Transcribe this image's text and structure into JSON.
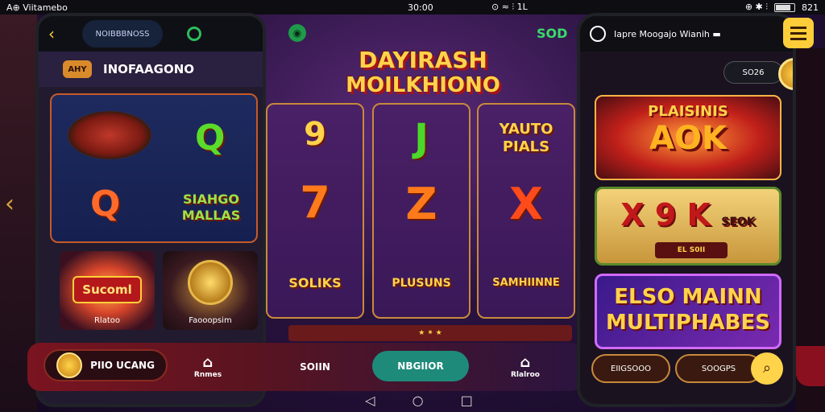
{
  "statusbar": {
    "left_text": "A⊕ Viitamebo",
    "time": "30:00",
    "right_a": "⊙ ≈ ⫶ 1L",
    "right_b": "⊕ ✱ ⫶",
    "battery_text": "821"
  },
  "left_phone": {
    "pill_label": "NOIBBBNOSS",
    "tag_label": "AHY",
    "section_title": "INOFAAGONO",
    "symbols": {
      "q1": "Q",
      "q2": "Q",
      "slot_text": "SIAHGO MALLAS"
    },
    "thumbs": [
      {
        "badge": "Sucoml",
        "label": "Rlatoo"
      },
      {
        "label": "Faooopsim"
      }
    ]
  },
  "header": {
    "balance": "SOD"
  },
  "logo": {
    "line1": "DAYIRASH",
    "line2": "MOILKHIONO"
  },
  "reels": [
    {
      "top": "9",
      "mid": "7",
      "bottom": "SOLIKS"
    },
    {
      "top": "J",
      "mid": "Z",
      "bottom": "PLUSUNS"
    },
    {
      "top": "YAUTO PIALS",
      "mid": "X",
      "bottom": "SAMHIINNE"
    }
  ],
  "reel_bar_text": "★ ⁕ ★",
  "bottom_nav": {
    "left_btn": "PIIO UCANG",
    "tab1": "Rnmes",
    "solin": "SOIIN",
    "register": "NBGIIOR",
    "tab2": "Rlalroo"
  },
  "right_phone": {
    "title": "Iapre Moogajo Wianih ▬",
    "balance_pill": "SO26",
    "card1": {
      "small": "PLAISINIS",
      "big": "AOK"
    },
    "card2": {
      "big": "X 9 K",
      "side": "SEOK",
      "foot": "EL S0II"
    },
    "card3": {
      "line1": "ELSO MAINN",
      "line2": "MULTIPHABES"
    },
    "btn_left": "EIIGSOOO",
    "btn_right": "SOOGPS"
  },
  "colors": {
    "accent_gold": "#ffd34a",
    "register_teal": "#1e8a7a",
    "balance_green": "#3adb6a"
  }
}
